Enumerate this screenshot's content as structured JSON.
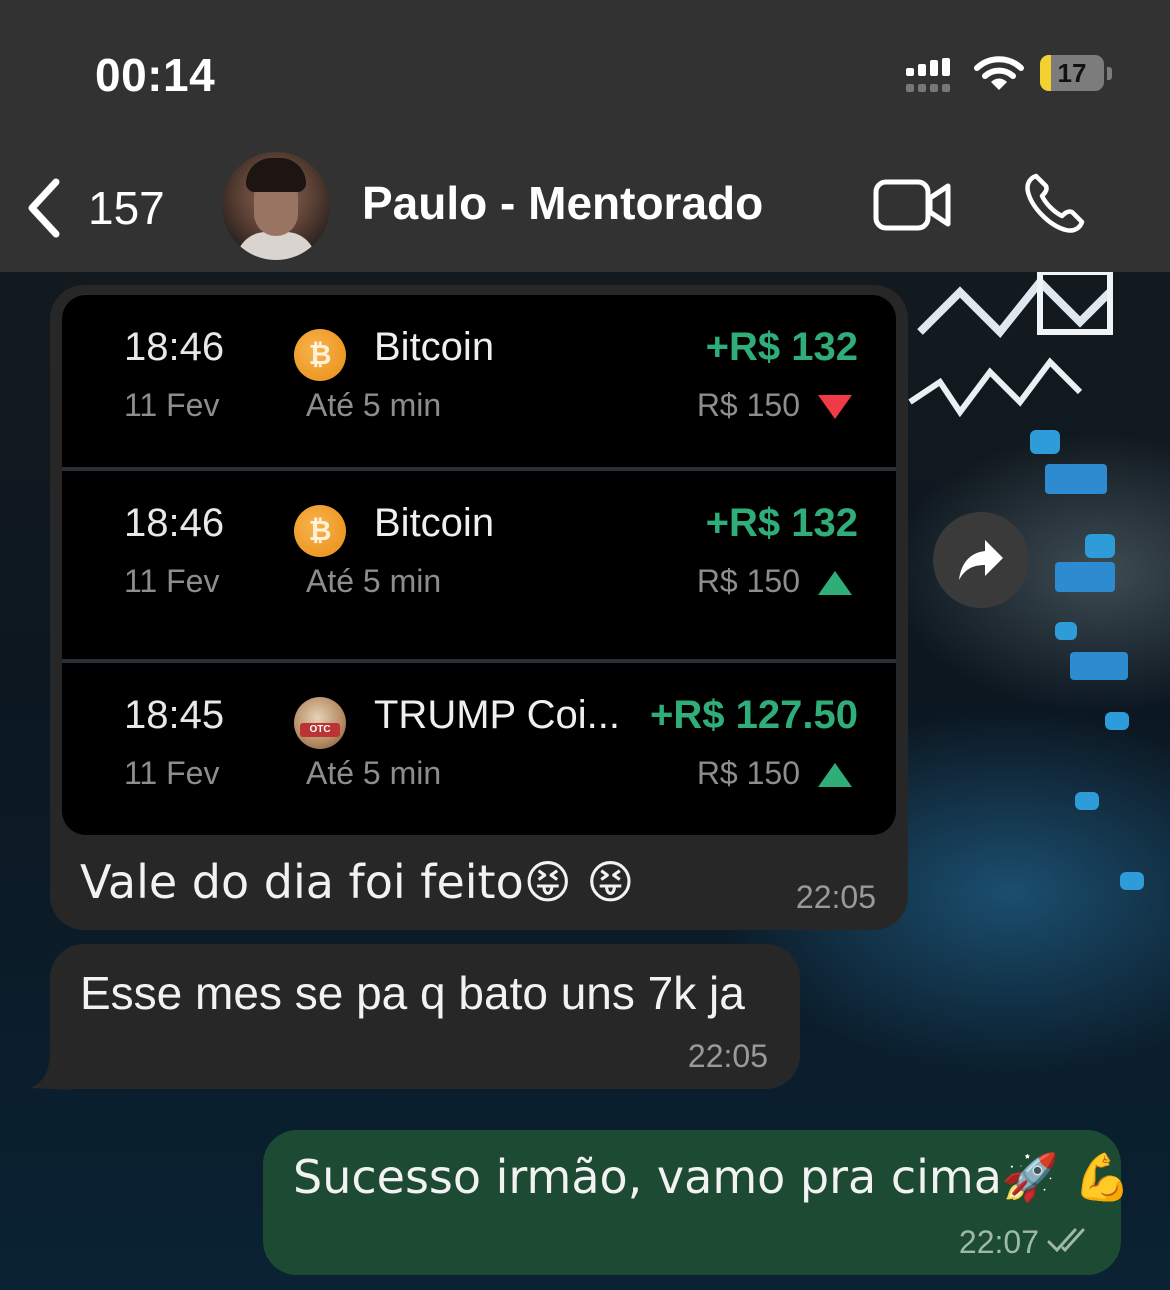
{
  "status_bar": {
    "time": "00:14",
    "battery_level": "17",
    "battery_fill_fraction": 0.17,
    "accent_battery": "#f3d230"
  },
  "header": {
    "back_icon": "chevron-left-icon",
    "unread_count": "157",
    "contact_name": "Paulo - Mentorado",
    "video_icon": "video-camera-icon",
    "call_icon": "phone-icon"
  },
  "messages": [
    {
      "direction": "incoming",
      "image": {
        "trades": [
          {
            "time": "18:46",
            "date": "11 Fev",
            "asset": "Bitcoin",
            "duration": "Até 5 min",
            "profit": "+R$ 132",
            "stake": "R$ 150",
            "direction": "down",
            "coin_icon": "bitcoin-icon"
          },
          {
            "time": "18:46",
            "date": "11 Fev",
            "asset": "Bitcoin",
            "duration": "Até 5 min",
            "profit": "+R$ 132",
            "stake": "R$ 150",
            "direction": "up",
            "coin_icon": "bitcoin-icon"
          },
          {
            "time": "18:45",
            "date": "11 Fev",
            "asset": "TRUMP Coi...",
            "duration": "Até 5 min",
            "profit": "+R$ 127.50",
            "stake": "R$ 150",
            "direction": "up",
            "coin_icon": "trump-coin-icon"
          }
        ],
        "coin_badge": "OTC"
      },
      "text": "Vale do dia foi feito😝 😝",
      "time": "22:05"
    },
    {
      "direction": "incoming",
      "text": "Esse mes se pa q bato uns 7k ja",
      "time": "22:05"
    },
    {
      "direction": "outgoing",
      "text": "Sucesso irmão, vamo pra cima🚀 💪",
      "time": "22:07",
      "status_icon": "double-check-icon"
    }
  ],
  "colors": {
    "profit_green": "#2fae79",
    "loss_red": "#ef3a48",
    "outgoing_bubble": "#1d4a33",
    "incoming_bubble": "#272727"
  }
}
